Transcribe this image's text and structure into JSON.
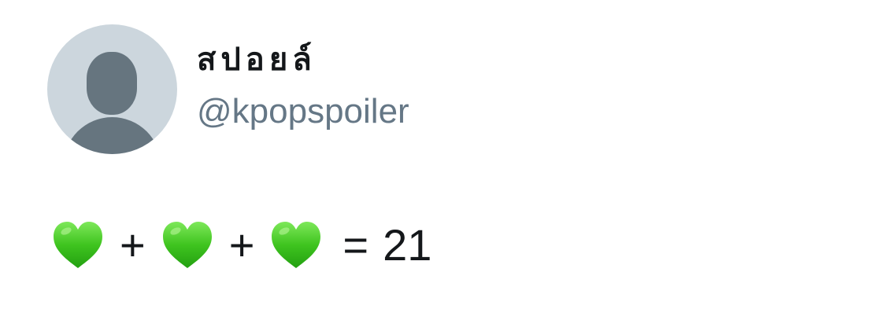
{
  "user": {
    "display_name": "สปอยล์",
    "handle": "@kpopspoiler"
  },
  "tweet": {
    "plus_1": "+",
    "plus_2": "+",
    "equals": "=",
    "result": "21",
    "emoji_icon": "green-heart-icon"
  },
  "colors": {
    "avatar_bg": "#ccd6dd",
    "avatar_figure": "#66757f",
    "handle": "#657786",
    "text": "#14171a",
    "heart_green": "#3fc41f"
  }
}
